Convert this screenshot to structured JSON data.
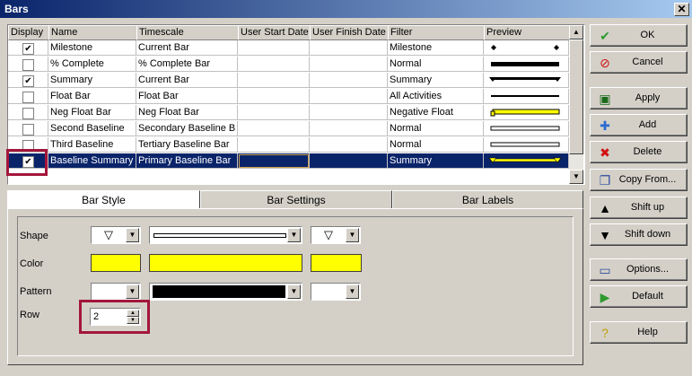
{
  "window": {
    "title": "Bars",
    "close_glyph": "✕"
  },
  "columns": [
    "Display",
    "Name",
    "Timescale",
    "User Start Date",
    "User Finish Date",
    "Filter",
    "Preview"
  ],
  "rows": [
    {
      "display": true,
      "name": "Milestone",
      "timescale": "Current Bar",
      "start": "",
      "finish": "",
      "filter": "Milestone",
      "preview": "milestone"
    },
    {
      "display": false,
      "name": "% Complete",
      "timescale": "% Complete Bar",
      "start": "",
      "finish": "",
      "filter": "Normal",
      "preview": "thick-black"
    },
    {
      "display": true,
      "name": "Summary",
      "timescale": "Current Bar",
      "start": "",
      "finish": "",
      "filter": "Summary",
      "preview": "summary-black"
    },
    {
      "display": false,
      "name": "Float Bar",
      "timescale": "Float Bar",
      "start": "",
      "finish": "",
      "filter": "All Activities",
      "preview": "thin-black"
    },
    {
      "display": false,
      "name": "Neg Float Bar",
      "timescale": "Neg Float Bar",
      "start": "",
      "finish": "",
      "filter": "Negative Float",
      "preview": "yellow-bar"
    },
    {
      "display": false,
      "name": "Second Baseline",
      "timescale": "Secondary Baseline B",
      "start": "",
      "finish": "",
      "filter": "Normal",
      "preview": "outline"
    },
    {
      "display": false,
      "name": "Third Baseline",
      "timescale": "Tertiary Baseline Bar",
      "start": "",
      "finish": "",
      "filter": "Normal",
      "preview": "outline"
    },
    {
      "display": true,
      "name": "Baseline Summary",
      "timescale": "Primary Baseline Bar",
      "start": "",
      "finish": "",
      "filter": "Summary",
      "preview": "summary-yellow",
      "selected": true
    }
  ],
  "tabs": [
    {
      "label": "Bar Style",
      "active": true
    },
    {
      "label": "Bar Settings",
      "active": false
    },
    {
      "label": "Bar Labels",
      "active": false
    }
  ],
  "bar_style": {
    "shape_label": "Shape",
    "color_label": "Color",
    "pattern_label": "Pattern",
    "row_label": "Row",
    "row_value": "2",
    "start_shape_glyph": "▽",
    "end_shape_glyph": "▽",
    "colors": {
      "start": "#ffff00",
      "middle": "#ffff00",
      "end": "#ffff00",
      "pattern_middle": "#000000"
    }
  },
  "buttons": [
    {
      "label": "OK",
      "icon": "check-icon",
      "glyph": "✔",
      "color": "#2e9a2e"
    },
    {
      "label": "Cancel",
      "icon": "cancel-icon",
      "glyph": "⊘",
      "color": "#d01010"
    },
    {
      "label": "Apply",
      "icon": "apply-icon",
      "glyph": "▣",
      "color": "#1a6a1a"
    },
    {
      "label": "Add",
      "icon": "add-icon",
      "glyph": "✚",
      "color": "#2a6ad0"
    },
    {
      "label": "Delete",
      "icon": "delete-icon",
      "glyph": "✖",
      "color": "#d01010"
    },
    {
      "label": "Copy From...",
      "icon": "copy-icon",
      "glyph": "❐",
      "color": "#2a4aa0"
    },
    {
      "label": "Shift up",
      "icon": "arrow-up-icon",
      "glyph": "▲",
      "color": "#000000"
    },
    {
      "label": "Shift down",
      "icon": "arrow-down-icon",
      "glyph": "▼",
      "color": "#000000"
    },
    {
      "label": "Options...",
      "icon": "options-icon",
      "glyph": "▭",
      "color": "#2a4aa0"
    },
    {
      "label": "Default",
      "icon": "default-icon",
      "glyph": "▶",
      "color": "#2e9a2e"
    },
    {
      "label": "Help",
      "icon": "help-icon",
      "glyph": "?",
      "color": "#c0a000"
    }
  ]
}
